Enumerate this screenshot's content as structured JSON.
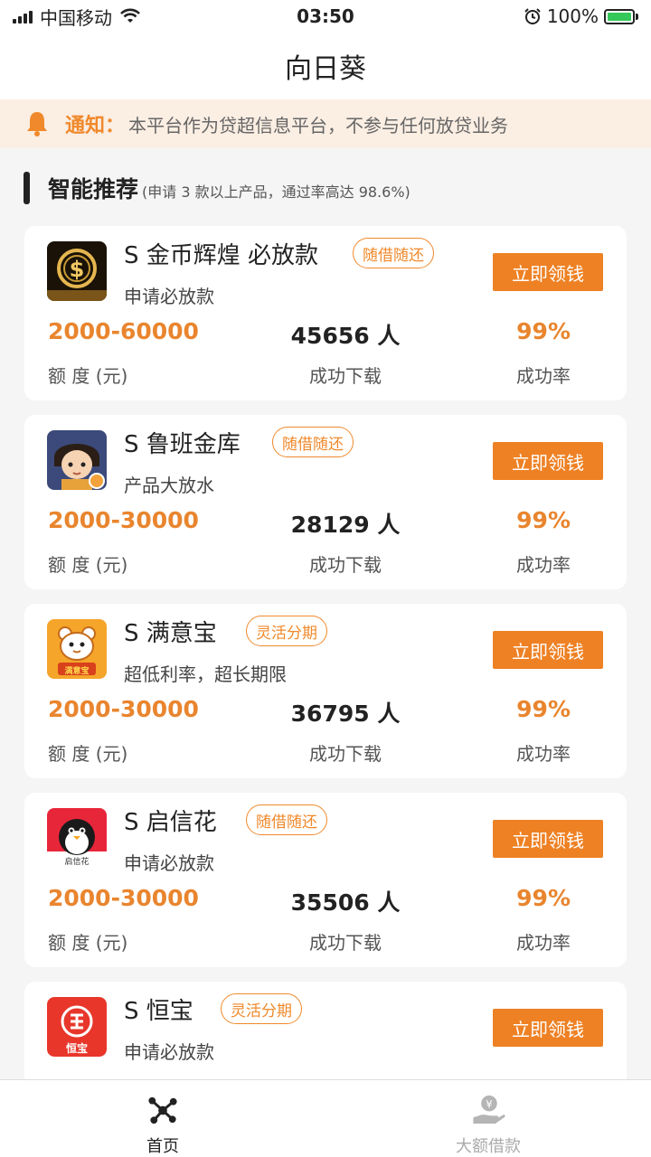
{
  "status_bar": {
    "carrier": "中国移动",
    "time": "03:50",
    "battery": "100%"
  },
  "nav": {
    "title": "向日葵"
  },
  "notice": {
    "label": "通知：",
    "text": "本平台作为贷超信息平台，不参与任何放贷业务"
  },
  "section": {
    "title": "智能推荐",
    "subtitle": "(申请 3 款以上产品，通过率高达 98.6%)"
  },
  "labels": {
    "amount": "额 度 (元)",
    "downloads": "成功下载",
    "rate": "成功率",
    "button": "立即领钱"
  },
  "products": [
    {
      "name": "S 金币辉煌 必放款",
      "tag": "随借随还",
      "desc": "申请必放款",
      "amount": "2000-60000",
      "downloads": "45656 人",
      "rate": "99%",
      "icon": "gold-coin-icon"
    },
    {
      "name": "S 鲁班金库",
      "tag": "随借随还",
      "desc": "产品大放水",
      "amount": "2000-30000",
      "downloads": "28129 人",
      "rate": "99%",
      "icon": "luban-character-icon"
    },
    {
      "name": "S 满意宝",
      "tag": "灵活分期",
      "desc": "超低利率，超长期限",
      "amount": "2000-30000",
      "downloads": "36795 人",
      "rate": "99%",
      "icon": "tiger-mascot-icon",
      "logo_text": "满意宝"
    },
    {
      "name": "S 启信花",
      "tag": "随借随还",
      "desc": "申请必放款",
      "amount": "2000-30000",
      "downloads": "35506 人",
      "rate": "99%",
      "icon": "penguin-icon",
      "logo_text": "启信花"
    },
    {
      "name": "S 恒宝",
      "tag": "灵活分期",
      "desc": "申请必放款",
      "amount": "",
      "downloads": "",
      "rate": "",
      "icon": "hengbao-logo-icon",
      "logo_text": "恒宝"
    }
  ],
  "tabbar": [
    {
      "label": "首页",
      "icon": "network-nodes-icon",
      "active": true
    },
    {
      "label": "大额借款",
      "icon": "hand-coin-icon",
      "active": false
    }
  ],
  "colors": {
    "accent": "#ee8124",
    "notice_bg": "#fbeee3",
    "battery": "#34c759"
  }
}
